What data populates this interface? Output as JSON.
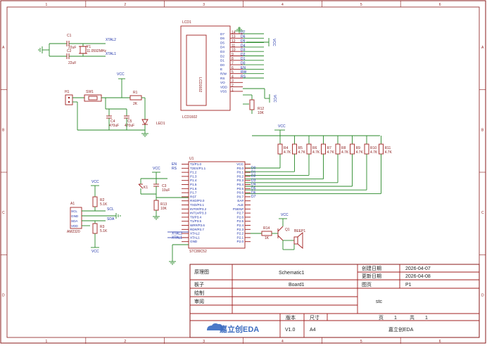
{
  "border": {
    "columns": [
      "1",
      "2",
      "3",
      "4",
      "5",
      "6"
    ],
    "rows": [
      "A",
      "B",
      "C",
      "D"
    ]
  },
  "parts": {
    "c1": {
      "ref": "C1",
      "val": "22uF"
    },
    "c2": {
      "ref": "C2",
      "val": "22uF"
    },
    "y1": {
      "ref": "Y1",
      "val": "11.0592MHz"
    },
    "xtal2": "XTAL2",
    "xtal1": "XTAL1",
    "vcc": "VCC",
    "h1": "H1",
    "sw1": "SW1",
    "r1": {
      "ref": "R1",
      "val": "2K"
    },
    "c4": {
      "ref": "C4",
      "val": "470uF"
    },
    "c5": {
      "ref": "C5",
      "val": "470uF"
    },
    "led1": "LED1",
    "lcd": {
      "ref": "LCD1",
      "name": "LCD1602",
      "val": "LCD1602"
    },
    "lcd_pins": [
      "D7",
      "D6",
      "D5",
      "D4",
      "D3",
      "D2",
      "D1",
      "D0",
      "E",
      "R/W",
      "RS",
      "VO",
      "VDD",
      "VSS"
    ],
    "lcd_pin_nums": [
      "14",
      "13",
      "12",
      "11",
      "10",
      "9",
      "8",
      "7",
      "6",
      "5",
      "4",
      "3",
      "2",
      "1"
    ],
    "lcd_net_labels": [
      "D7",
      "D6",
      "D5",
      "D4",
      "D3",
      "D2",
      "D1",
      "D0",
      "EN",
      "RW",
      "RS"
    ],
    "r12": {
      "ref": "R12",
      "val": "10K"
    },
    "rs": [
      {
        "ref": "R4",
        "val": "4.7K"
      },
      {
        "ref": "R5",
        "val": "4.7K"
      },
      {
        "ref": "R6",
        "val": "4.7K"
      },
      {
        "ref": "R7",
        "val": "4.7K"
      },
      {
        "ref": "R8",
        "val": "4.7K"
      },
      {
        "ref": "R9",
        "val": "4.7K"
      },
      {
        "ref": "R10",
        "val": "4.7K"
      },
      {
        "ref": "R11",
        "val": "4.7K"
      }
    ],
    "u1": {
      "ref": "U1",
      "val": "STC89C52"
    },
    "u1_left": [
      "T2/P1.0",
      "T2EX/P1.1",
      "P1.2",
      "P1.3",
      "P1.4",
      "P1.5",
      "P1.6",
      "P1.7",
      "RST",
      "RXD/P3.0",
      "TXD/P3.1",
      "INT0#/P3.2",
      "INT1#/P3.3",
      "T0/P3.4",
      "T1/P3.5",
      "WR#/P3.6",
      "RD#/P3.7",
      "XTAL2",
      "XTAL1",
      "GND"
    ],
    "u1_right": [
      "VCC",
      "P0.0",
      "P0.1",
      "P0.2",
      "P0.3",
      "P0.4",
      "P0.5",
      "P0.6",
      "P0.7",
      "EA#",
      "ALE",
      "PSEN#",
      "P2.7",
      "P2.6",
      "P2.5",
      "P2.4",
      "P2.3",
      "P2.2",
      "P2.1",
      "P2.0"
    ],
    "u1_left_nets": [
      "EN",
      "RS",
      "",
      "",
      "",
      "",
      "",
      "",
      "",
      "",
      "",
      "",
      "",
      "",
      "",
      "",
      "",
      "XTAL2",
      "XTAL1",
      ""
    ],
    "u1_right_nets": [
      "",
      "D0",
      "D1",
      "D2",
      "D3",
      "D4",
      "D5",
      "D6",
      "D7",
      "",
      "",
      "",
      "",
      "",
      "",
      "",
      "",
      "",
      "",
      ""
    ],
    "k1": "K1",
    "c3": {
      "ref": "C3",
      "val": "10uF"
    },
    "r13": {
      "ref": "R13",
      "val": "10K"
    },
    "a1": {
      "ref": "A1",
      "val": "AM2320",
      "pins": [
        "SCL",
        "GND",
        "SDA",
        "VDD"
      ]
    },
    "r2": {
      "ref": "R2",
      "val": "5.1K"
    },
    "r3": {
      "ref": "R3",
      "val": "5.1K"
    },
    "scl": "SCL",
    "sda": "SDA",
    "r14": {
      "ref": "R14",
      "val": "1K"
    },
    "q1": "Q1",
    "beep": "BEEP1",
    "sensor_nets": [
      "EN",
      "RW",
      "RS"
    ]
  },
  "title_block": {
    "label_diagram": "原理图",
    "value_diagram": "Schematic1",
    "label_board": "板子",
    "value_board": "Board1",
    "label_draw": "绘制",
    "label_review": "审阅",
    "label_created": "创建日期",
    "value_created": "2026-04-07",
    "label_updated": "更新日期",
    "value_updated": "2026-04-08",
    "label_page": "图页",
    "value_page": "P1",
    "company": "stc",
    "label_version": "版本",
    "label_size": "尺寸",
    "page_word": "页",
    "page_num": "1",
    "total_word": "共",
    "total_num": "1",
    "value_version": "V1.0",
    "value_size": "A4",
    "value_creator": "嘉立创EDA",
    "logo_text": "嘉立创EDA"
  }
}
